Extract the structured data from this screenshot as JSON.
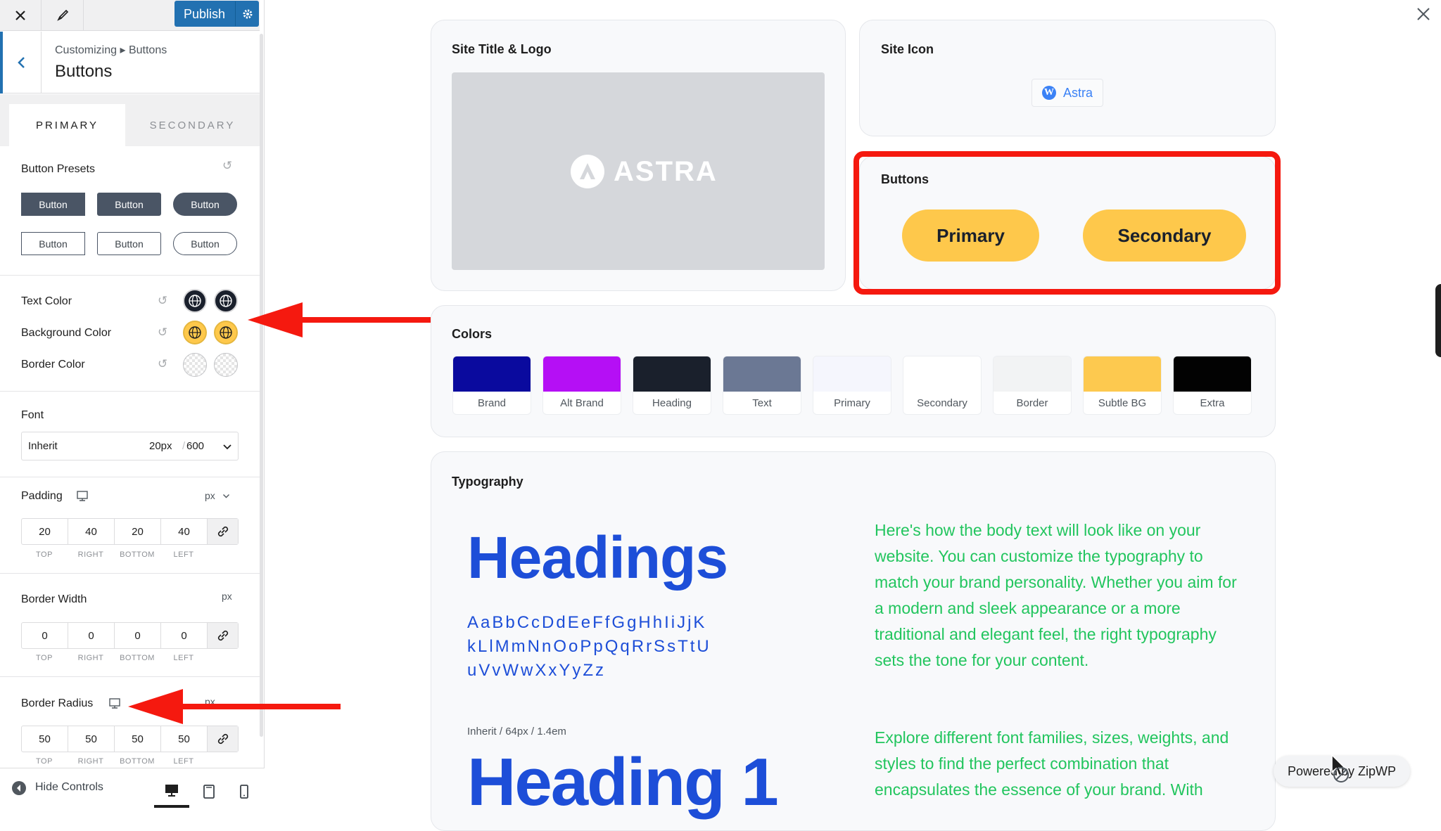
{
  "topbar": {
    "publish_label": "Publish"
  },
  "header": {
    "breadcrumb": "Customizing ▸ Buttons",
    "title": "Buttons"
  },
  "tabs": [
    {
      "label": "PRIMARY"
    },
    {
      "label": "SECONDARY"
    }
  ],
  "presets": {
    "label": "Button Presets",
    "items": [
      "Button",
      "Button",
      "Button",
      "Button",
      "Button",
      "Button"
    ]
  },
  "colors_section": {
    "text_color": "Text Color",
    "background_color": "Background Color",
    "border_color": "Border Color",
    "swatch_colors": {
      "text": "#1a202c",
      "background": "#fec84b"
    }
  },
  "font": {
    "label": "Font",
    "family": "Inherit",
    "size": "20px",
    "weight": "600"
  },
  "padding": {
    "label": "Padding",
    "unit": "px",
    "values": [
      "20",
      "40",
      "20",
      "40"
    ],
    "sides": [
      "TOP",
      "RIGHT",
      "BOTTOM",
      "LEFT"
    ]
  },
  "border_width": {
    "label": "Border Width",
    "unit": "px",
    "values": [
      "0",
      "0",
      "0",
      "0"
    ],
    "sides": [
      "TOP",
      "RIGHT",
      "BOTTOM",
      "LEFT"
    ]
  },
  "border_radius": {
    "label": "Border Radius",
    "unit": "px",
    "values": [
      "50",
      "50",
      "50",
      "50"
    ],
    "sides": [
      "TOP",
      "RIGHT",
      "BOTTOM",
      "LEFT"
    ]
  },
  "footer": {
    "hide_controls": "Hide Controls"
  },
  "preview": {
    "site_title_card": {
      "title": "Site Title & Logo",
      "logo_text": "ASTRA"
    },
    "site_icon_card": {
      "title": "Site Icon",
      "site_name": "Astra"
    },
    "buttons_card": {
      "title": "Buttons",
      "primary": "Primary",
      "secondary": "Secondary"
    },
    "colors_card": {
      "title": "Colors",
      "palette": [
        {
          "name": "Brand",
          "hex": "#0a0a9e"
        },
        {
          "name": "Alt Brand",
          "hex": "#b50ff5"
        },
        {
          "name": "Heading",
          "hex": "#1a202c"
        },
        {
          "name": "Text",
          "hex": "#6b7894"
        },
        {
          "name": "Primary",
          "hex": "#f5f6fd"
        },
        {
          "name": "Secondary",
          "hex": "#ffffff"
        },
        {
          "name": "Border",
          "hex": "#f2f3f4"
        },
        {
          "name": "Subtle BG",
          "hex": "#fdc94f"
        },
        {
          "name": "Extra",
          "hex": "#020202"
        }
      ]
    },
    "typography_card": {
      "title": "Typography",
      "headings": "Headings",
      "alphabet_lines": [
        "AaBbCcDdEeFfGgHhIiJjK",
        "kLlMmNnOoPpQqRrSsTtU",
        "uVvWwXxYyZz"
      ],
      "meta": "Inherit / 64px / 1.4em",
      "heading1": "Heading 1",
      "body_paragraph_1": "Here's how the body text will look like on your website. You can customize the typography to match your brand personality. Whether you aim for a modern and sleek appearance or a more traditional and elegant feel, the right typography sets the tone for your content.",
      "body_paragraph_2": "Explore different font families, sizes, weights, and styles to find the perfect combination that encapsulates the essence of your brand. With"
    },
    "powered_by": "Powered by ZipWP"
  }
}
